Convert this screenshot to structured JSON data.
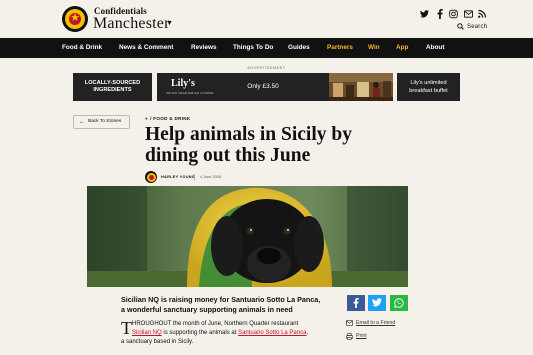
{
  "header": {
    "brand_small": "Confidentials",
    "brand_big": "Manchester",
    "search_label": "Search",
    "social_icons": [
      "twitter-icon",
      "facebook-icon",
      "instagram-icon",
      "email-icon",
      "rss-icon"
    ]
  },
  "nav": {
    "items": [
      {
        "label": "Food & Drink",
        "highlight": false
      },
      {
        "label": "News & Comment",
        "highlight": false
      },
      {
        "label": "Reviews",
        "highlight": false
      },
      {
        "label": "Things To Do",
        "highlight": false
      },
      {
        "label": "Guides",
        "highlight": false
      },
      {
        "label": "Partners",
        "highlight": true
      },
      {
        "label": "Win",
        "highlight": true
      },
      {
        "label": "App",
        "highlight": true
      },
      {
        "label": "About",
        "highlight": false
      }
    ]
  },
  "ad": {
    "label": "ADVERTISEMENT",
    "left_text_1": "LOCALLY-SOURCED",
    "left_text_2": "INGREDIENTS",
    "brand": "Lily's",
    "brand_sub": "INDIAN VEGETARIAN CUISINE",
    "price": "Only £3.50",
    "right_text_1": "Lily's unlimited",
    "right_text_2": "breakfast buffet"
  },
  "article": {
    "back_label": "Back To Stories",
    "category": "/ FOOD & DRINK",
    "title_line1": "Help animals in Sicily by",
    "title_line2": "dining out this June",
    "author": "HARLEY YOUNG",
    "date": "4 June 2026",
    "lede_line1": "Sicilian NQ is raising money for Santuario Sotto La Panca,",
    "lede_line2": "a wonderful sanctuary supporting animals in need",
    "dropcap": "T",
    "body_line1": "HROUGHOUT the month of June, Northern Quarter restaurant",
    "body_link1": "Sicilian NQ",
    "body_line2_mid": " is supporting the animals at ",
    "body_link2": "Santuario Sotto La Panca",
    "body_line2_end": ",",
    "body_line3": "a sanctuary based in Sicily."
  },
  "sidebar": {
    "email_label": "Email to a Friend",
    "print_label": "Print"
  },
  "colors": {
    "nav_bg": "#111111",
    "nav_highlight": "#f5b82e",
    "link": "#c0142b",
    "facebook": "#3b5998",
    "twitter": "#1da1f2",
    "whatsapp": "#2bb741"
  }
}
